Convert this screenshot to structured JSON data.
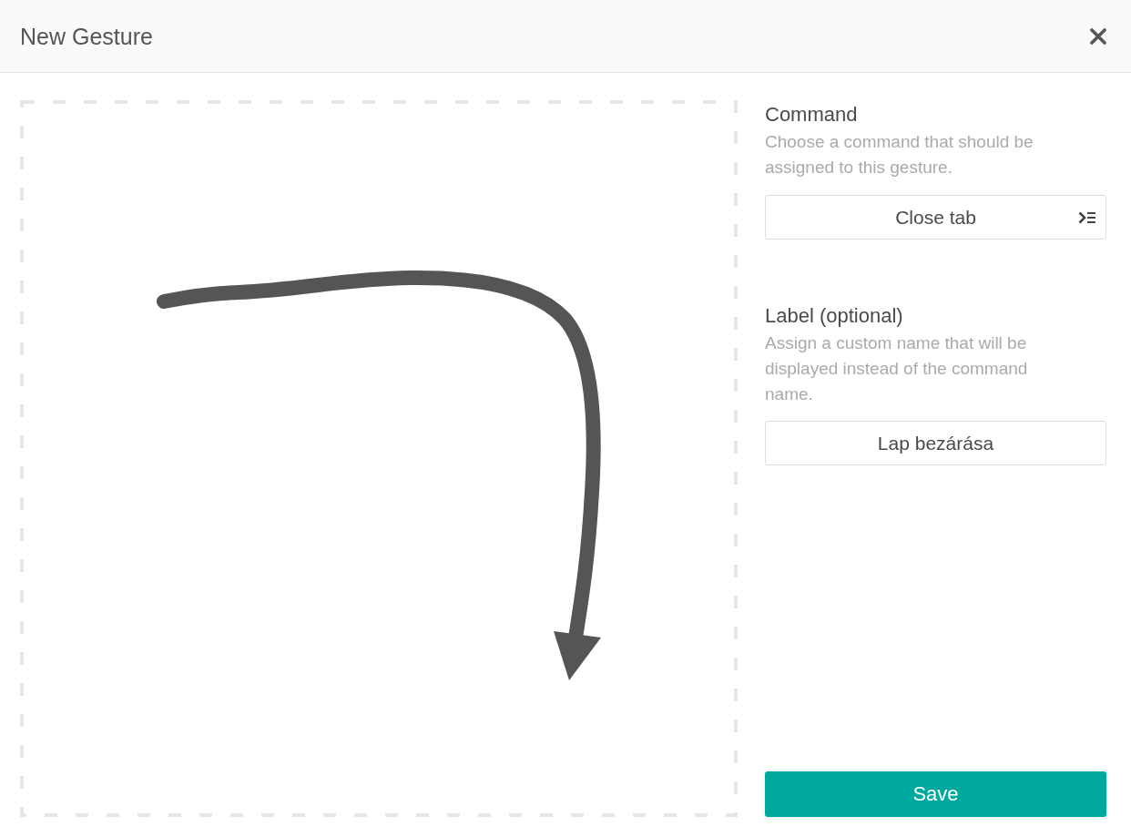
{
  "header": {
    "title": "New Gesture"
  },
  "command": {
    "heading": "Command",
    "description": "Choose a command that should be assigned to this gesture.",
    "value": "Close tab"
  },
  "label": {
    "heading": "Label (optional)",
    "description": "Assign a custom name that will be displayed instead of the command name.",
    "value": "Lap bezárása"
  },
  "save_button": {
    "label": "Save"
  }
}
